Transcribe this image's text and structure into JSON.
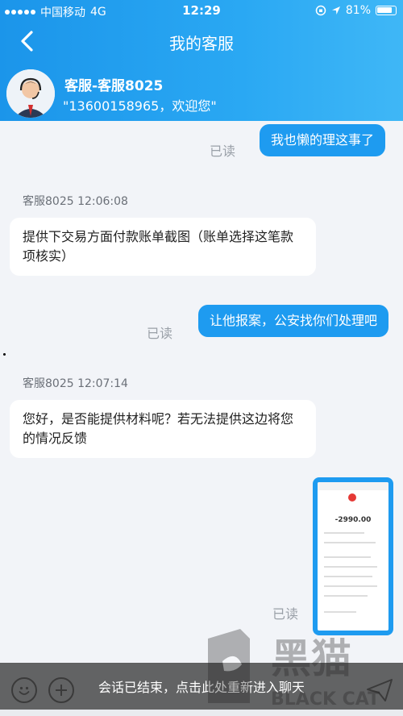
{
  "status": {
    "carrier": "中国移动",
    "network": "4G",
    "time": "12:29",
    "battery": "81%"
  },
  "navbar": {
    "title": "我的客服"
  },
  "agent": {
    "name": "客服-客服8025",
    "subtitle": "\"13600158965，欢迎您\""
  },
  "messages": [
    {
      "type": "out",
      "text": "我也懒的理这事了",
      "read": "已读"
    },
    {
      "type": "in",
      "time": "客服8025 12:06:08",
      "text": "提供下交易方面付款账单截图（账单选择这笔款项核实）"
    },
    {
      "type": "out",
      "text": "让他报案，公安找你们处理吧",
      "read": "已读"
    },
    {
      "type": "in",
      "time": "客服8025 12:07:14",
      "text": "您好，是否能提供材料呢？若无法提供这边将您的情况反馈"
    },
    {
      "type": "image",
      "amount": "-2990.00",
      "read": "已读"
    }
  ],
  "bottom": {
    "ended_notice": "会话已结束，点击此处重新进入聊天"
  },
  "watermark": {
    "text": "黑猫",
    "sub": "BLACK CAT"
  },
  "colors": {
    "accent": "#1e9bf0",
    "header": "#2aa8f3"
  },
  "icons": {
    "back": "chevron-left-icon",
    "emoji": "emoji-icon",
    "plus": "plus-icon",
    "send": "send-icon"
  }
}
